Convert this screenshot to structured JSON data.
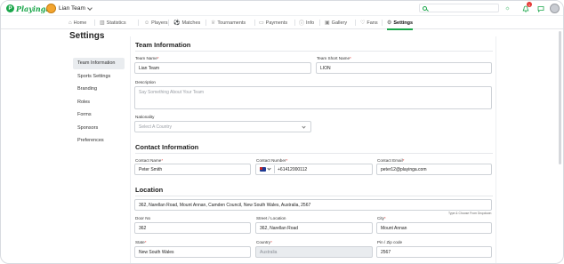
{
  "app": {
    "brand": "Playinga",
    "team": "Lian Team"
  },
  "topbar": {
    "search_placeholder": "",
    "notifications_count": "1"
  },
  "nav": [
    {
      "label": "Home",
      "icon": "home-icon"
    },
    {
      "label": "Statistics",
      "icon": "chart-icon"
    },
    {
      "label": "Players",
      "icon": "players-icon"
    },
    {
      "label": "Matches",
      "icon": "matches-icon"
    },
    {
      "label": "Tournaments",
      "icon": "trophy-icon"
    },
    {
      "label": "Payments",
      "icon": "payment-icon"
    },
    {
      "label": "Info",
      "icon": "info-icon"
    },
    {
      "label": "Gallery",
      "icon": "gallery-icon"
    },
    {
      "label": "Fans",
      "icon": "heart-icon"
    },
    {
      "label": "Settings",
      "icon": "gear-icon",
      "active": true
    }
  ],
  "page": {
    "title": "Settings"
  },
  "side_menu": [
    {
      "label": "Team Information",
      "active": true
    },
    {
      "label": "Sports Settings"
    },
    {
      "label": "Branding"
    },
    {
      "label": "Roles"
    },
    {
      "label": "Forms"
    },
    {
      "label": "Sponsors"
    },
    {
      "label": "Preferences"
    }
  ],
  "team_info": {
    "title": "Team Information",
    "team_name_label": "Team Name",
    "team_name": "Lian Team",
    "short_name_label": "Team Short Name",
    "short_name": "LION",
    "description_label": "Description",
    "description_placeholder": "Say Something About Your Team",
    "nationality_label": "Nationality",
    "nationality_placeholder": "Select A Country"
  },
  "contact": {
    "title": "Contact Information",
    "name_label": "Contact Name",
    "name": "Peter Smith",
    "number_label": "Contact Number",
    "number": "+61412000112",
    "email_label": "Contact Email",
    "email": "peter12@playinga.com"
  },
  "location": {
    "title": "Location",
    "address": "362, Narellan Road, Mount Annan, Camden Council, New South Wales, Australia, 2567",
    "hint": "Type & Choose From Dropdown",
    "door_label": "Door No",
    "door": "362",
    "street_label": "Street / Location",
    "street": "362, Narellan Road",
    "city_label": "City",
    "city": "Mount Annan",
    "state_label": "State",
    "state": "New South Wales",
    "country_label": "Country",
    "country": "Australia",
    "zip_label": "Pin / Zip code",
    "zip": "2567"
  },
  "colors": {
    "brand": "#1aa64a",
    "required": "#e53935"
  }
}
